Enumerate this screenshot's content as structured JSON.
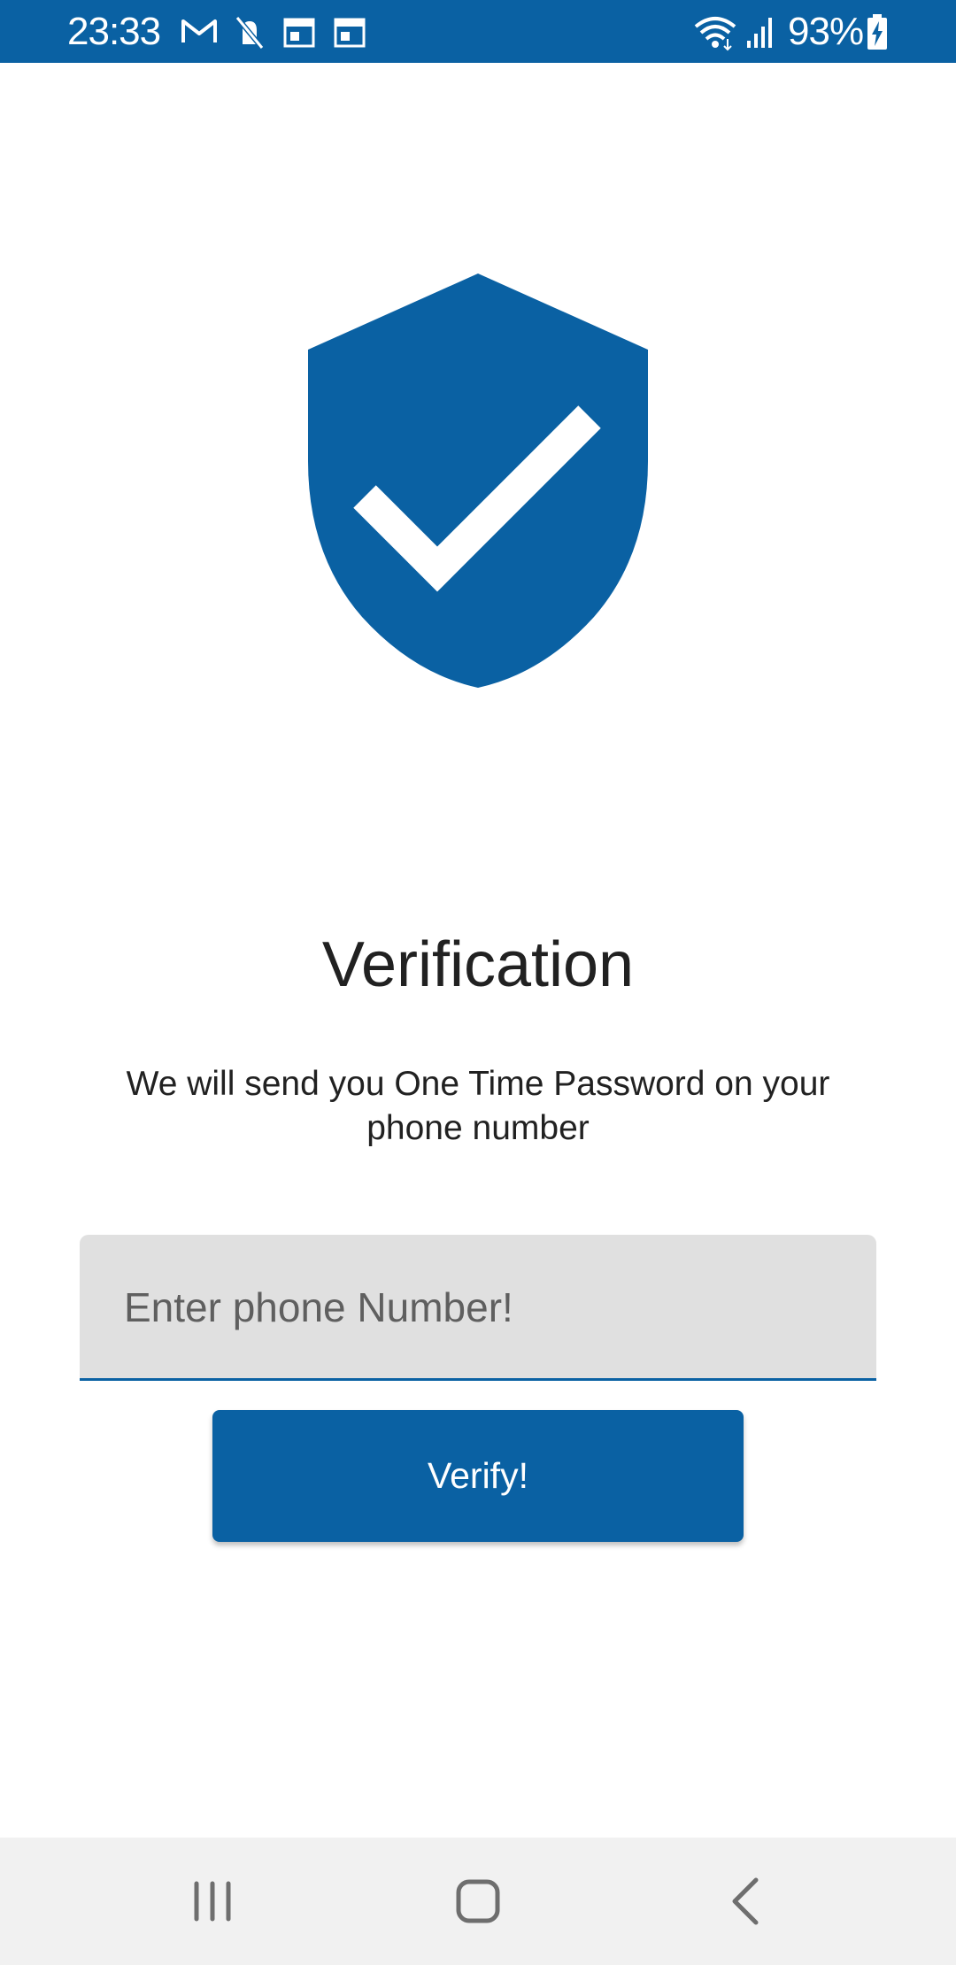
{
  "status_bar": {
    "time": "23:33",
    "battery_percent": "93%",
    "left_icons": [
      "gmail-icon",
      "notification-muted-icon",
      "calendar-icon",
      "calendar-icon"
    ],
    "right_icons": [
      "wifi-icon",
      "signal-icon",
      "battery-charging-icon"
    ]
  },
  "colors": {
    "brand": "#0a61a3",
    "field_bg": "#e0e0e0",
    "nav_bg": "#f1f1f1"
  },
  "main": {
    "icon": "shield-check-icon",
    "title": "Verification",
    "subtitle": "We will send you One Time Password on your phone number",
    "phone_field": {
      "placeholder": "Enter phone Number!",
      "value": ""
    },
    "verify_button": "Verify!"
  },
  "nav_bar": {
    "buttons": [
      "recent-apps-icon",
      "home-icon",
      "back-icon"
    ]
  }
}
